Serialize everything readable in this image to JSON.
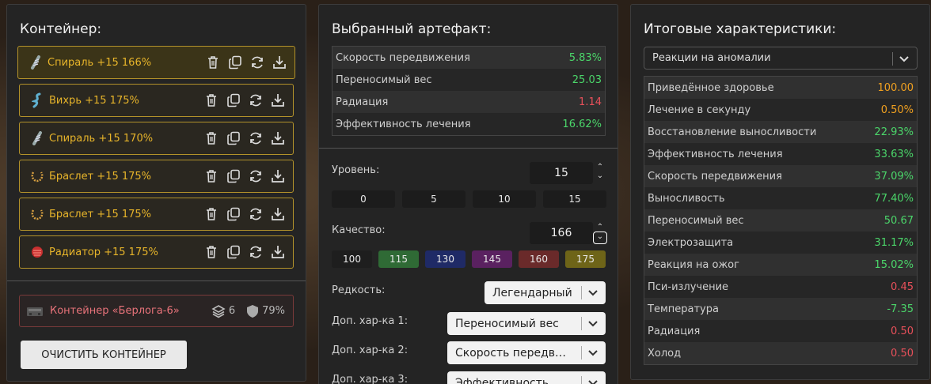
{
  "container_panel": {
    "title": "Контейнер:",
    "items": [
      {
        "label": "Спираль +15 166%",
        "icon": "spiral-icon",
        "selected": true
      },
      {
        "label": "Вихрь +15 175%",
        "icon": "whirl-icon",
        "selected": false
      },
      {
        "label": "Спираль +15 170%",
        "icon": "spiral-icon",
        "selected": false
      },
      {
        "label": "Браслет +15 175%",
        "icon": "bracelet-icon",
        "selected": false
      },
      {
        "label": "Браслет +15 175%",
        "icon": "bracelet-icon",
        "selected": false
      },
      {
        "label": "Радиатор +15 175%",
        "icon": "radiator-icon",
        "selected": false
      }
    ],
    "container": {
      "label": "Контейнер «Берлога-6»",
      "slots": "6",
      "protection": "79%"
    },
    "clear_button": "ОЧИСТИТЬ КОНТЕЙНЕР"
  },
  "artifact_panel": {
    "title": "Выбранный артефакт:",
    "stats": [
      {
        "name": "Скорость передвижения",
        "value": "5.83%",
        "color": "green"
      },
      {
        "name": "Переносимый вес",
        "value": "25.03",
        "color": "green"
      },
      {
        "name": "Радиация",
        "value": "1.14",
        "color": "red"
      },
      {
        "name": "Эффективность лечения",
        "value": "16.62%",
        "color": "green"
      }
    ],
    "level_label": "Уровень:",
    "level_value": "15",
    "level_presets": [
      "0",
      "5",
      "10",
      "15"
    ],
    "quality_label": "Качество:",
    "quality_value": "166",
    "quality_presets": [
      {
        "label": "100",
        "color": "#1e1e1e"
      },
      {
        "label": "115",
        "color": "#2f6a35"
      },
      {
        "label": "130",
        "color": "#1f2a66"
      },
      {
        "label": "145",
        "color": "#5a2160"
      },
      {
        "label": "160",
        "color": "#6a2a2a"
      },
      {
        "label": "175",
        "color": "#6e6418"
      }
    ],
    "rarity_label": "Редкость:",
    "rarity_value": "Легендарный",
    "extra1_label": "Доп. хар-ка 1:",
    "extra1_value": "Переносимый вес",
    "extra2_label": "Доп. хар-ка 2:",
    "extra2_value": "Скорость передви...",
    "extra3_label": "Доп. хар-ка 3:",
    "extra3_value": "Эффективность ле..."
  },
  "totals_panel": {
    "title": "Итоговые характеристики:",
    "filter_value": "Реакции на аномалии",
    "stats": [
      {
        "name": "Приведённое здоровье",
        "value": "100.00",
        "color": "orange"
      },
      {
        "name": "Лечение в секунду",
        "value": "0.50%",
        "color": "orange"
      },
      {
        "name": "Восстановление выносливости",
        "value": "22.93%",
        "color": "green"
      },
      {
        "name": "Эффективность лечения",
        "value": "33.63%",
        "color": "green"
      },
      {
        "name": "Скорость передвижения",
        "value": "37.09%",
        "color": "green"
      },
      {
        "name": "Выносливость",
        "value": "77.40%",
        "color": "green"
      },
      {
        "name": "Переносимый вес",
        "value": "50.67",
        "color": "green"
      },
      {
        "name": "Электрозащита",
        "value": "31.17%",
        "color": "green"
      },
      {
        "name": "Реакция на ожог",
        "value": "15.02%",
        "color": "green"
      },
      {
        "name": "Пси-излучение",
        "value": "0.45",
        "color": "red"
      },
      {
        "name": "Температура",
        "value": "-7.35",
        "color": "green"
      },
      {
        "name": "Радиация",
        "value": "0.50",
        "color": "red"
      },
      {
        "name": "Холод",
        "value": "0.50",
        "color": "red"
      }
    ]
  }
}
